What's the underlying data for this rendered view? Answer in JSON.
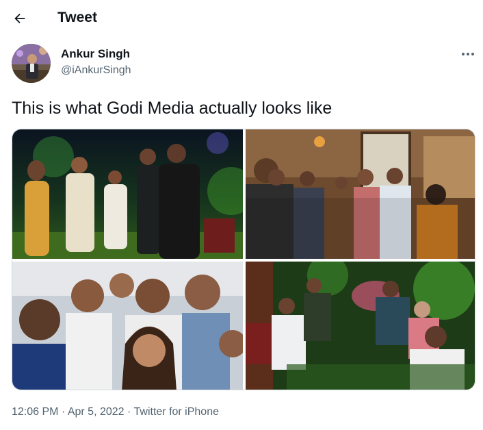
{
  "header": {
    "title": "Tweet"
  },
  "tweet": {
    "author_name": "Ankur Singh",
    "author_handle": "@iAnkurSingh",
    "text": "This is what Godi Media actually looks like",
    "time": "12:06 PM",
    "separator": "·",
    "date": "Apr 5, 2022",
    "source": "Twitter for iPhone"
  },
  "icons": {
    "back": "arrow-left-icon",
    "more": "more-horizontal-icon"
  },
  "colors": {
    "text": "#0f1419",
    "secondary": "#536471",
    "border": "#cfd9de"
  }
}
